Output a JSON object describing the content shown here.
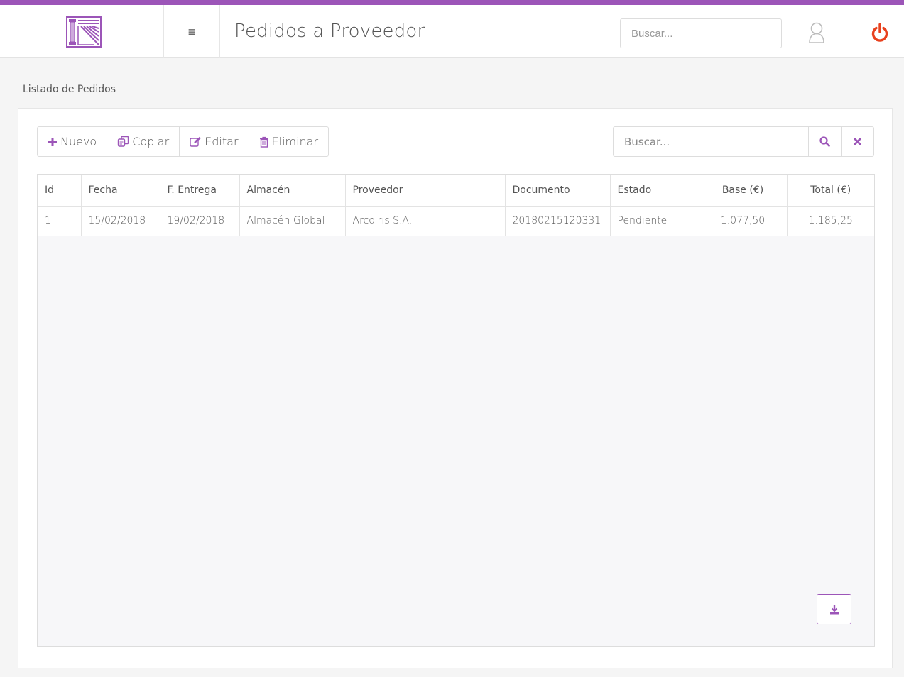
{
  "header": {
    "title": "Pedidos a Proveedor",
    "search_placeholder": "Buscar...",
    "menu_icon": "≡"
  },
  "section": {
    "title": "Listado de Pedidos"
  },
  "toolbar": {
    "nuevo": "Nuevo",
    "copiar": "Copiar",
    "editar": "Editar",
    "eliminar": "Eliminar"
  },
  "list_search": {
    "placeholder": "Buscar..."
  },
  "table": {
    "columns": [
      "Id",
      "Fecha",
      "F. Entrega",
      "Almacén",
      "Proveedor",
      "Documento",
      "Estado",
      "Base (€)",
      "Total (€)"
    ],
    "rows": [
      [
        "1",
        "15/02/2018",
        "19/02/2018",
        "Almacén Global",
        "Arcoiris S.A.",
        "20180215120331",
        "Pendiente",
        "1.077,50",
        "1.185,25"
      ]
    ]
  },
  "colors": {
    "accent": "#9c55b8",
    "power": "#e8411e"
  },
  "icons": {
    "logo": "columns-logo-icon",
    "user": "user-icon",
    "power": "power-icon",
    "search": "search-icon",
    "clear": "close-icon",
    "export": "download-icon"
  }
}
